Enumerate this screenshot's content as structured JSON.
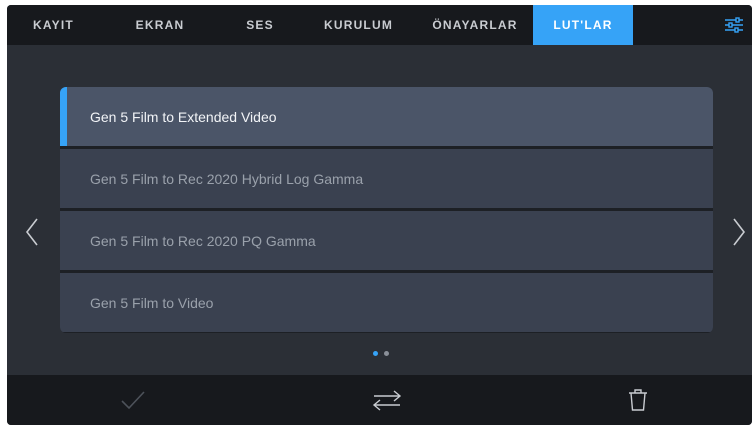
{
  "tabs": [
    {
      "label": "KAYIT"
    },
    {
      "label": "EKRAN"
    },
    {
      "label": "SES"
    },
    {
      "label": "KURULUM"
    },
    {
      "label": "ÖNAYARLAR"
    },
    {
      "label": "LUT'LAR",
      "active": true
    }
  ],
  "settings_icon": "sliders-icon",
  "lut_list": [
    {
      "label": "Gen 5 Film to Extended Video",
      "selected": true
    },
    {
      "label": "Gen 5 Film to Rec 2020 Hybrid Log Gamma"
    },
    {
      "label": "Gen 5 Film to Rec 2020 PQ Gamma"
    },
    {
      "label": "Gen 5 Film to Video"
    }
  ],
  "pagination": {
    "current": 1,
    "total": 2
  },
  "toolbar": {
    "confirm_icon": "checkmark-icon",
    "swap_icon": "swap-arrows-icon",
    "delete_icon": "trash-icon"
  },
  "colors": {
    "accent": "#36a3f7",
    "panel": "#2b2f36",
    "bar": "#17191d",
    "item": "#3a4150",
    "item_selected": "#4b5568"
  }
}
